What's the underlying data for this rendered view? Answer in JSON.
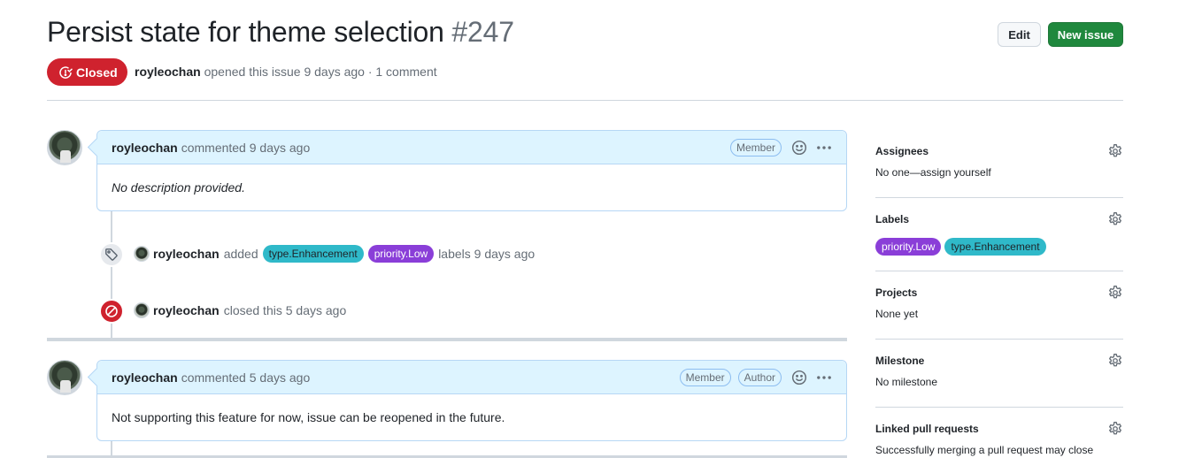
{
  "issue": {
    "title": "Persist state for theme selection",
    "number": "#247",
    "state": "Closed",
    "author": "royleochan",
    "opened_text": "opened this issue 9 days ago · 1 comment"
  },
  "buttons": {
    "edit": "Edit",
    "new_issue": "New issue"
  },
  "comments": [
    {
      "author": "royleochan",
      "action": "commented 9 days ago",
      "badges": [
        "Member"
      ],
      "body": "No description provided."
    },
    {
      "author": "royleochan",
      "action": "commented 5 days ago",
      "badges": [
        "Member",
        "Author"
      ],
      "body": "Not supporting this feature for now, issue can be reopened in the future."
    }
  ],
  "events": {
    "labeled": {
      "actor": "royleochan",
      "verb": "added",
      "labels": [
        "type.Enhancement",
        "priority.Low"
      ],
      "suffix": "labels 9 days ago"
    },
    "closed": {
      "actor": "royleochan",
      "text": "closed this 5 days ago"
    }
  },
  "sidebar": {
    "assignees": {
      "heading": "Assignees",
      "value": "No one—assign yourself"
    },
    "labels": {
      "heading": "Labels",
      "items": [
        "priority.Low",
        "type.Enhancement"
      ]
    },
    "projects": {
      "heading": "Projects",
      "value": "None yet"
    },
    "milestone": {
      "heading": "Milestone",
      "value": "No milestone"
    },
    "linked_prs": {
      "heading": "Linked pull requests",
      "value": "Successfully merging a pull request may close"
    }
  },
  "colors": {
    "closed_red": "#cf222e",
    "primary_green": "#1f883d",
    "comment_header_bg": "#ddf4ff",
    "label_enhancement": "#2fb9c9",
    "label_low": "#8a3ed8"
  },
  "icons": [
    "issue-closed-icon",
    "smiley-icon",
    "kebab-horizontal-icon",
    "tag-icon",
    "circle-slash-icon",
    "gear-icon"
  ]
}
